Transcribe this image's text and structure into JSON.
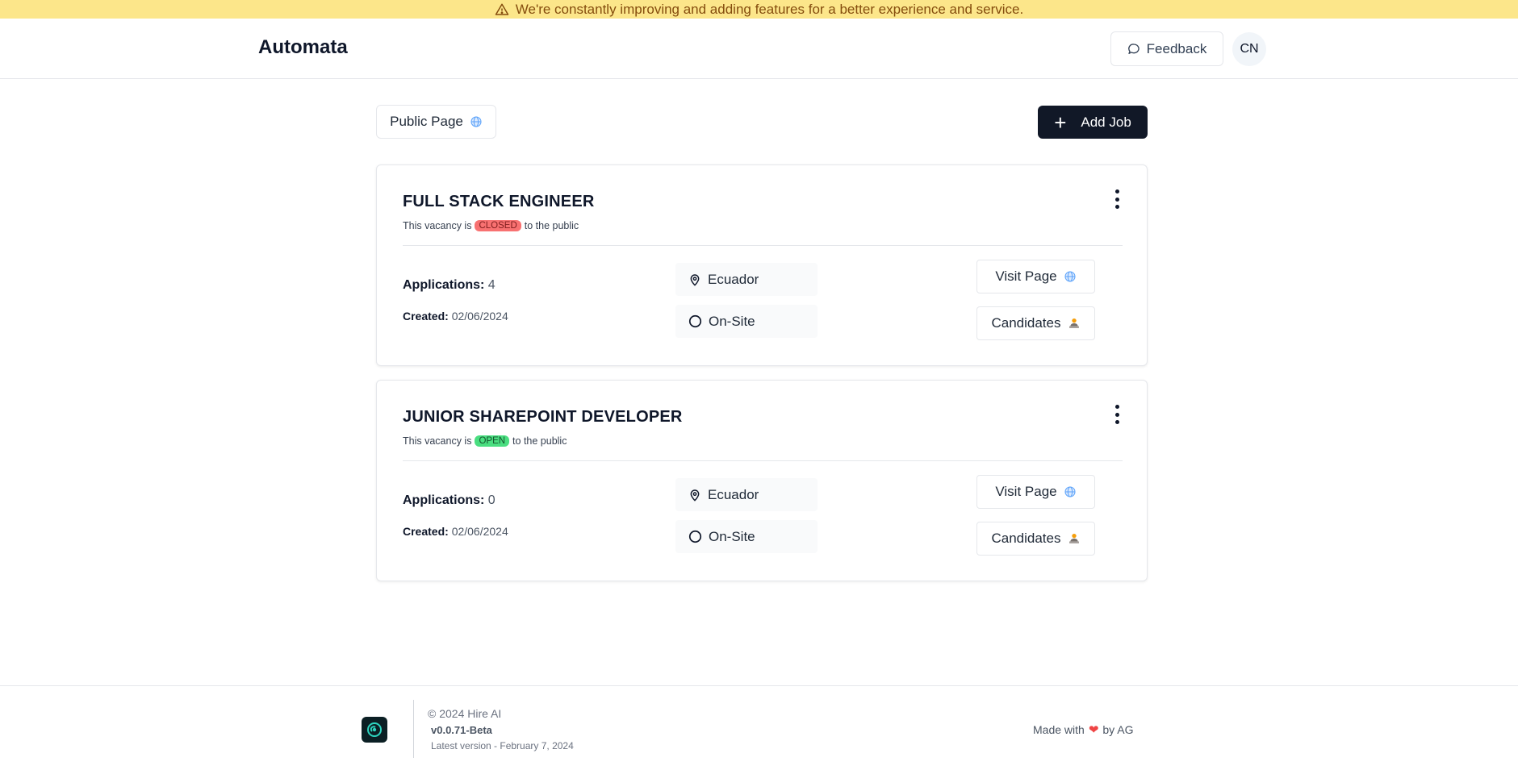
{
  "banner": {
    "text": "We're constantly improving and adding features for a better experience and service.",
    "icon": "warning-icon"
  },
  "header": {
    "brand": "Automata",
    "feedback_label": "Feedback",
    "avatar_initials": "CN"
  },
  "toolbar": {
    "public_page_label": "Public Page",
    "add_job_label": "Add Job"
  },
  "jobs": [
    {
      "title": "FULL STACK ENGINEER",
      "sub_prefix": "This vacancy is",
      "status": "CLOSED",
      "sub_suffix": "to the public",
      "applications_label": "Applications:",
      "applications": "4",
      "created_label": "Created:",
      "created": "02/06/2024",
      "location": "Ecuador",
      "work_mode": "On-Site",
      "visit_label": "Visit Page",
      "candidates_label": "Candidates"
    },
    {
      "title": "JUNIOR SHAREPOINT DEVELOPER",
      "sub_prefix": "This vacancy is",
      "status": "OPEN",
      "sub_suffix": "to the public",
      "applications_label": "Applications:",
      "applications": "0",
      "created_label": "Created:",
      "created": "02/06/2024",
      "location": "Ecuador",
      "work_mode": "On-Site",
      "visit_label": "Visit Page",
      "candidates_label": "Candidates"
    }
  ],
  "footer": {
    "copyright": "© 2024 Hire AI",
    "version": "v0.0.71-Beta",
    "latest": "Latest version - February 7, 2024",
    "made_with": "Made with",
    "by": "by AG"
  },
  "colors": {
    "banner": "#fce68a",
    "primary": "#111827",
    "closed": "#f87171",
    "open": "#4ade80"
  }
}
